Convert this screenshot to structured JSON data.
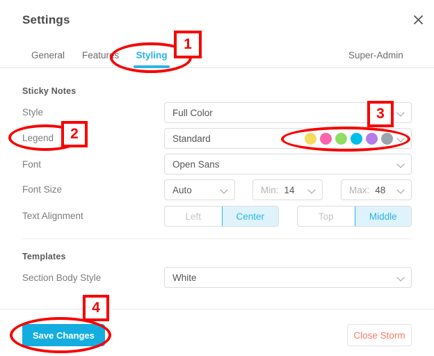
{
  "header": {
    "title": "Settings",
    "close_icon": "close-icon"
  },
  "tabs": [
    {
      "label": "General",
      "active": false
    },
    {
      "label": "Features",
      "active": false
    },
    {
      "label": "Styling",
      "active": true
    },
    {
      "label": "Super-Admin",
      "active": false
    }
  ],
  "sections": {
    "sticky_notes": {
      "heading": "Sticky Notes",
      "style": {
        "label": "Style",
        "value": "Full Color"
      },
      "legend": {
        "label": "Legend",
        "value": "Standard"
      },
      "font": {
        "label": "Font",
        "value": "Open Sans"
      },
      "font_size": {
        "label": "Font Size",
        "mode": "Auto",
        "min_prefix": "Min:",
        "min_value": "14",
        "max_prefix": "Max:",
        "max_value": "48"
      },
      "text_alignment": {
        "label": "Text Alignment",
        "horizontal": {
          "options": [
            "Left",
            "Center"
          ],
          "selected": "Center"
        },
        "vertical": {
          "options": [
            "Top",
            "Middle"
          ],
          "selected": "Middle"
        }
      }
    },
    "templates": {
      "heading": "Templates",
      "section_body_style": {
        "label": "Section Body Style",
        "value": "White"
      }
    }
  },
  "legend_swatches": [
    {
      "name": "yellow",
      "color": "#f6d95f"
    },
    {
      "name": "pink",
      "color": "#fb63ad"
    },
    {
      "name": "green",
      "color": "#8fdd63"
    },
    {
      "name": "cyan",
      "color": "#00bdea"
    },
    {
      "name": "purple",
      "color": "#b57cea"
    },
    {
      "name": "gray",
      "color": "#9aa5ae"
    }
  ],
  "footer": {
    "save_label": "Save Changes",
    "close_label": "Close Storm"
  },
  "annotations": [
    {
      "number": "1"
    },
    {
      "number": "2"
    },
    {
      "number": "3"
    },
    {
      "number": "4"
    }
  ],
  "colors": {
    "accent": "#2ab4e8",
    "primary_button": "#14ade0",
    "danger_text": "#fa7a6c",
    "annotation": "#f70000"
  }
}
